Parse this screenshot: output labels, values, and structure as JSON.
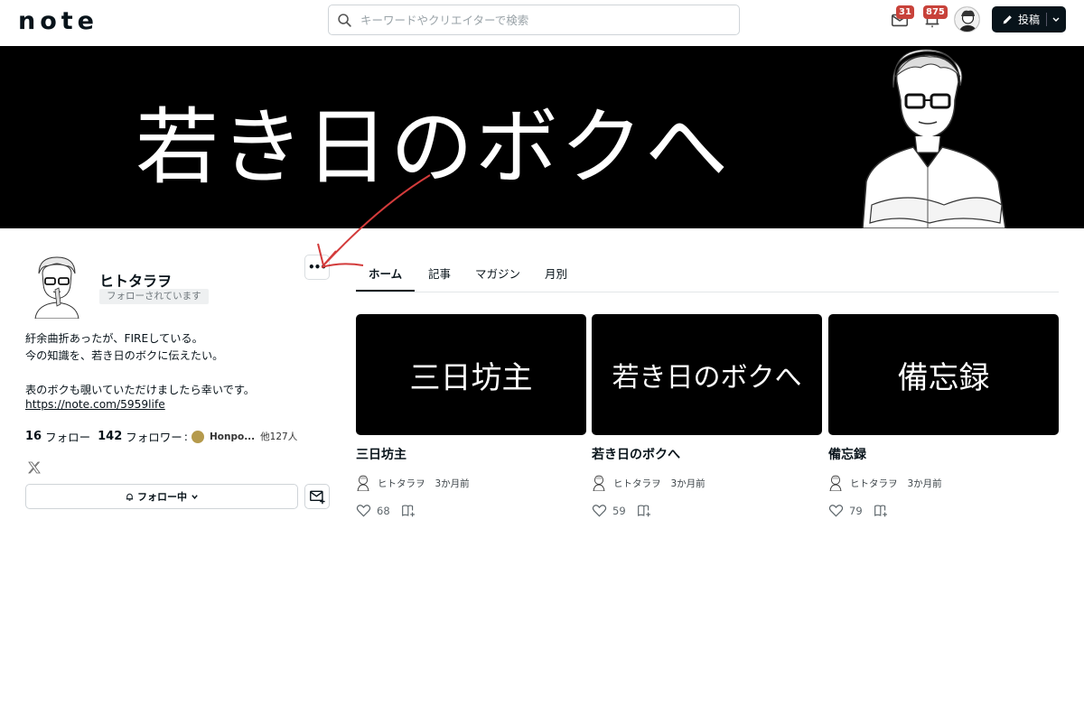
{
  "header": {
    "logo": "note",
    "search_placeholder": "キーワードやクリエイターで検索",
    "messages_badge": "31",
    "notifications_badge": "875",
    "post_label": "投稿"
  },
  "banner": {
    "title": "若き日のボクへ"
  },
  "profile": {
    "name": "ヒトタラヲ",
    "followed_label": "フォローされています",
    "more_label": "•••",
    "bio_line1": "紆余曲折あったが、FIREしている。",
    "bio_line2": "今の知識を、若き日のボクに伝えたい。",
    "bio_line3": "表のボクも覗いていただけましたら幸いです。",
    "link": "https://note.com/5959life",
    "following_count": "16",
    "following_label": "フォロー",
    "followers_count": "142",
    "followers_label": "フォロワー",
    "follower_sample": "Honpo...",
    "follower_more": "他127人",
    "follow_button_label": "フォロー中"
  },
  "tabs": [
    {
      "label": "ホーム"
    },
    {
      "label": "記事"
    },
    {
      "label": "マガジン"
    },
    {
      "label": "月別"
    }
  ],
  "cards": [
    {
      "thumb_text": "三日坊主",
      "title": "三日坊主",
      "author": "ヒトタラヲ",
      "date": "3か月前",
      "likes": "68"
    },
    {
      "thumb_text": "若き日のボクへ",
      "title": "若き日のボクへ",
      "author": "ヒトタラヲ",
      "date": "3か月前",
      "likes": "59"
    },
    {
      "thumb_text": "備忘録",
      "title": "備忘録",
      "author": "ヒトタラヲ",
      "date": "3か月前",
      "likes": "79"
    }
  ],
  "colors": {
    "badge": "#c8423a",
    "arrow": "#d33b3b",
    "dark": "#08131a"
  }
}
